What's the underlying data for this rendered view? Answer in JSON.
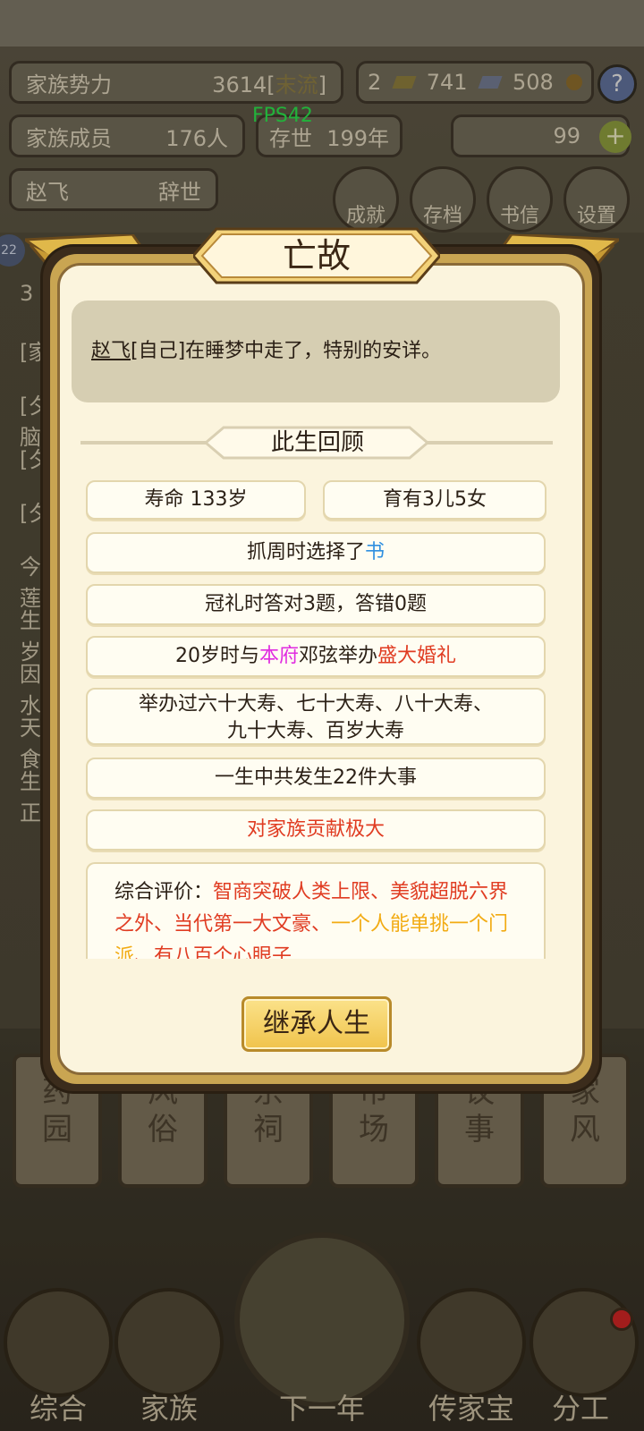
{
  "hud": {
    "power_label": "家族势力",
    "power_value": "3614",
    "power_rank_open": "[",
    "power_rank": "末流",
    "power_rank_close": "]",
    "members_label": "家族成员",
    "members_value": "176人",
    "survive_label": "存世",
    "survive_value": "199年",
    "player_name": "赵飞",
    "player_status": "辞世",
    "gold_bars": "2",
    "silver": "741",
    "cloth": "508",
    "ingots": "99",
    "help": "?",
    "plus": "+",
    "fps": "FPS42"
  },
  "top_buttons": [
    "成就",
    "存档",
    "书信",
    "设置"
  ],
  "background_list": {
    "badge": "22",
    "items": [
      "3",
      "[家",
      "[夕脑",
      "[夕",
      "[夕",
      "今莲",
      "生岁",
      "因水",
      "天食",
      "生正"
    ]
  },
  "bottom_tabs": [
    [
      "药",
      "园"
    ],
    [
      "风",
      "俗"
    ],
    [
      "宗",
      "祠"
    ],
    [
      "市",
      "场"
    ],
    [
      "议",
      "事"
    ],
    [
      "家",
      "风"
    ]
  ],
  "bottom_nav": [
    "综合",
    "家族",
    "下一年",
    "传家宝",
    "分工"
  ],
  "modal": {
    "title": "亡故",
    "message_name": "赵飞",
    "message_rest": "[自己]在睡梦中走了，特别的安详。",
    "section_title": "此生回顾",
    "lifespan": "寿命 133岁",
    "children": "育有3儿5女",
    "zhuazhou_prefix": "抓周时选择了",
    "zhuazhou_item": "书",
    "guanli": "冠礼时答对3题，答错0题",
    "wedding_prefix": "20岁时与",
    "wedding_house": "本府",
    "wedding_spouse": "邓弦举办",
    "wedding_type": "盛大婚礼",
    "birthdays_line1": "举办过六十大寿、七十大寿、八十大寿、",
    "birthdays_line2": "九十大寿、百岁大寿",
    "events": "一生中共发生22件大事",
    "contribution": "对家族贡献极大",
    "eval_label": "综合评价：",
    "eval_red_1": "智商突破人类上限、美貌超脱六界之外、当代第一大文豪、",
    "eval_orange": "一个人能单挑一个门派",
    "eval_sep": "、",
    "eval_red_2": "有八百个心眼子",
    "button": "继承人生"
  },
  "colors": {
    "highlight_blue": "#2f8fe0",
    "highlight_magenta": "#e02ce0",
    "highlight_red": "#e03c22",
    "highlight_orange": "#f2ab13",
    "modal_bg": "#fbf4dd",
    "button_gold": "#f0c34b"
  }
}
